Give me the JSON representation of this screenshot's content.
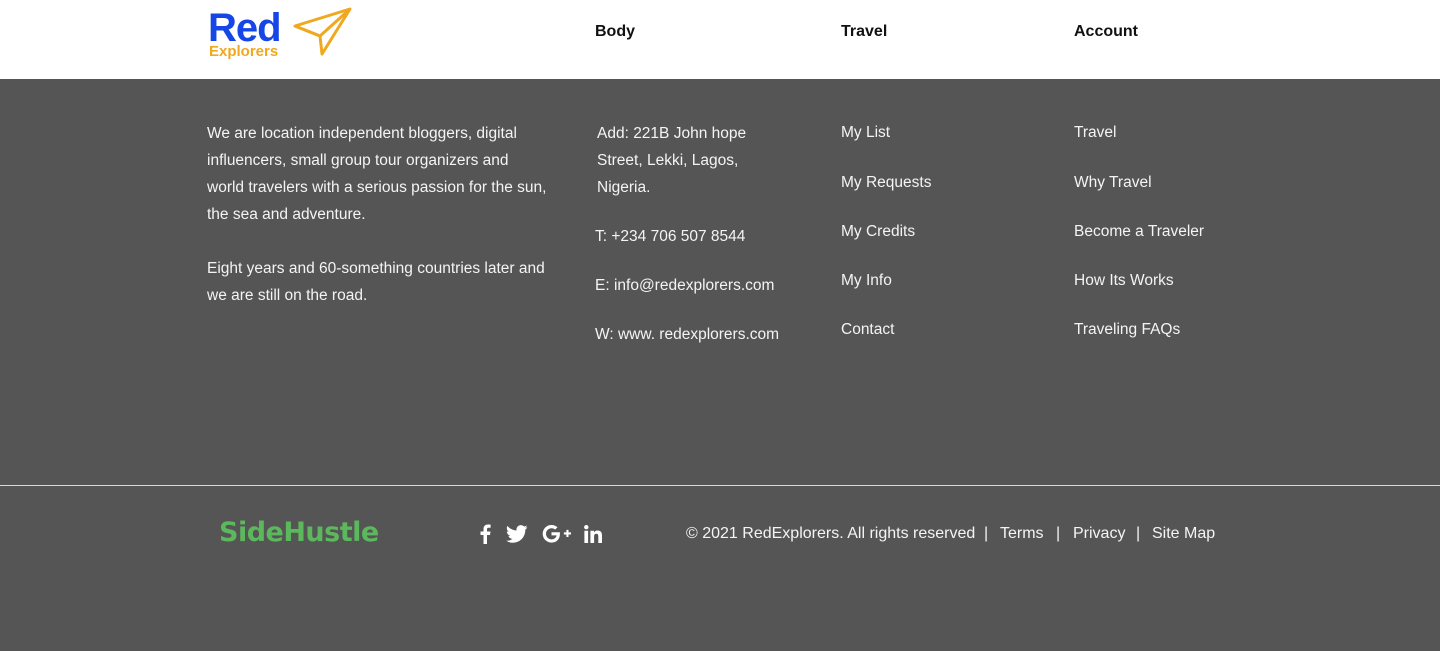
{
  "brand": {
    "name": "Red",
    "subtitle": "Explorers",
    "colors": {
      "primary": "#1646e6",
      "accent": "#f0a81e"
    }
  },
  "nav": {
    "body_heading": "Body",
    "travel_heading": "Travel",
    "account_heading": "Account"
  },
  "about": {
    "paragraph_1": "We are location independent bloggers, digital influencers, small group tour organizers and world travelers with a serious passion for the sun, the sea and adventure.",
    "paragraph_2": "Eight years and 60-something countries later and we are still on the road."
  },
  "contact": {
    "address_line_1": "Add: 221B John hope",
    "address_line_2": "Street, Lekki, Lagos,",
    "address_line_3": "Nigeria.",
    "phone": "T: +234 706 507 8544",
    "email": "E: info@redexplorers.com",
    "website": "W: www. redexplorers.com"
  },
  "travel_links": [
    "My List",
    "My Requests",
    "My Credits",
    "My Info",
    "Contact"
  ],
  "account_links": [
    "Travel",
    "Why Travel",
    "Become a Traveler",
    "How Its Works",
    "Traveling FAQs"
  ],
  "partner": {
    "name": "SideHustle",
    "color": "#5cb85c"
  },
  "social": [
    "facebook-icon",
    "twitter-icon",
    "google-plus-icon",
    "linkedin-icon"
  ],
  "footer": {
    "copyright": "© 2021 RedExplorers. All rights reserved",
    "separator": "|",
    "terms": "Terms",
    "privacy": "Privacy",
    "sitemap": "Site Map"
  },
  "colors": {
    "footer_bg": "#555555",
    "header_bg": "#ffffff"
  }
}
